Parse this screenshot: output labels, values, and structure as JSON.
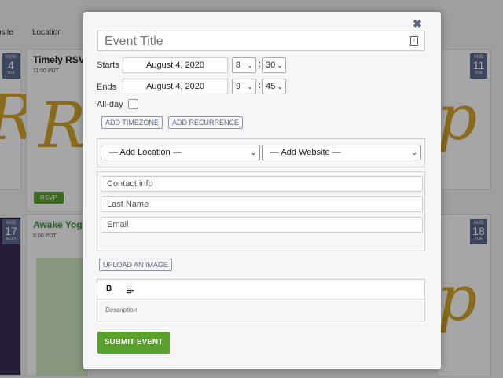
{
  "background": {
    "nav": [
      "bsite",
      "Location"
    ],
    "cards": [
      {
        "month": "AUG",
        "day": "4",
        "weekday": "TUE",
        "title": "Timely RSV",
        "time": "11:00 PDT",
        "rsvp": "RSVP"
      },
      {
        "month": "AUG",
        "day": "11",
        "weekday": "TUE"
      },
      {
        "month": "AUG",
        "day": "17",
        "weekday": "MON",
        "title": "Awake Yog",
        "time": "6:00 PDT"
      },
      {
        "month": "AUG",
        "day": "18",
        "weekday": "TUE"
      }
    ]
  },
  "modal": {
    "close_icon": "close-icon",
    "title_placeholder": "Event Title",
    "starts": {
      "label": "Starts",
      "date": "August 4, 2020",
      "hour": "8",
      "minute": "30"
    },
    "ends": {
      "label": "Ends",
      "date": "August 4, 2020",
      "hour": "9",
      "minute": "45"
    },
    "allday_label": "All-day",
    "add_timezone": "ADD TIMEZONE",
    "add_recurrence": "ADD RECURRENCE",
    "location_select": "— Add Location —",
    "website_select": "— Add Website —",
    "contact_placeholder": "Contact info",
    "lastname_placeholder": "Last Name",
    "email_placeholder": "Email",
    "upload_image": "UPLOAD AN IMAGE",
    "bold": "B",
    "description_placeholder": "Description",
    "submit": "SUBMIT EVENT"
  },
  "colors": {
    "accent_green": "#5aa02c",
    "badge_blue": "#5c6a8f",
    "gold": "#d4a42a"
  }
}
